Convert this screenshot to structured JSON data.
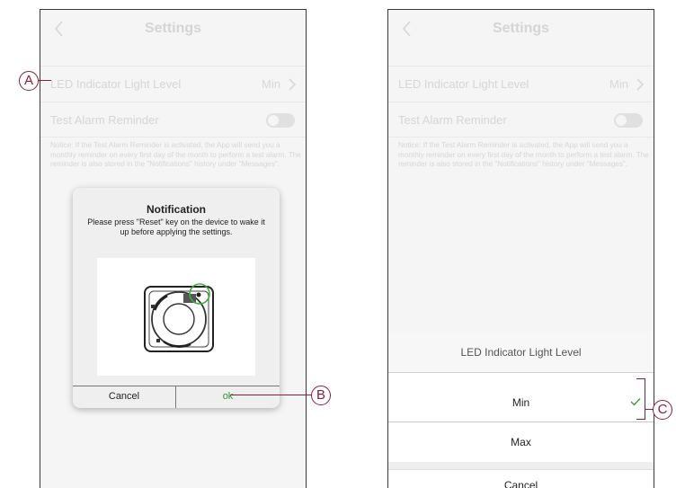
{
  "left_screen": {
    "header": {
      "title": "Settings"
    },
    "settings": {
      "led_label": "LED Indicator Light Level",
      "led_value": "Min",
      "alarm_label": "Test Alarm Reminder",
      "notice": "Notice: If the Test Alarm Reminder is activated, the App will send you a monthly reminder on every first day of the month to perform a test alarm. The reminder is also stored in the \"Notifications\" history under \"Messages\"."
    },
    "dialog": {
      "title": "Notification",
      "message": "Please press \"Reset\" key on the device to wake it up before applying the settings.",
      "cancel_label": "Cancel",
      "ok_label": "ok"
    }
  },
  "right_screen": {
    "header": {
      "title": "Settings"
    },
    "settings": {
      "led_label": "LED Indicator Light Level",
      "led_value": "Min",
      "alarm_label": "Test Alarm Reminder",
      "notice": "Notice: If the Test Alarm Reminder is activated, the App will send you a monthly reminder on every first day of the month to perform a test alarm. The reminder is also stored in the \"Notifications\" history under \"Messages\"."
    },
    "sheet": {
      "title": "LED Indicator Light Level",
      "options": [
        {
          "label": "Min",
          "selected": true
        },
        {
          "label": "Max",
          "selected": false
        }
      ],
      "cancel_label": "Cancel"
    }
  },
  "callouts": {
    "a": "A",
    "b": "B",
    "c": "C"
  },
  "colors": {
    "callout": "#8a1c3c",
    "ok_green": "#2e9b2e",
    "device_ring": "#3bb03b"
  }
}
